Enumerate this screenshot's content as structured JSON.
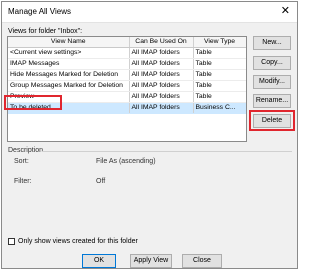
{
  "window": {
    "title": "Manage All Views",
    "close_glyph": "✕"
  },
  "views_label": "Views for folder \"Inbox\":",
  "table": {
    "columns": [
      "View Name",
      "Can Be Used On",
      "View Type"
    ],
    "rows": [
      {
        "name": "<Current view settings>",
        "used_on": "All IMAP folders",
        "type": "Table"
      },
      {
        "name": "IMAP Messages",
        "used_on": "All IMAP folders",
        "type": "Table"
      },
      {
        "name": "Hide Messages Marked for Deletion",
        "used_on": "All IMAP folders",
        "type": "Table"
      },
      {
        "name": "Group Messages Marked for Deletion",
        "used_on": "All IMAP folders",
        "type": "Table"
      },
      {
        "name": "Preview",
        "used_on": "All IMAP folders",
        "type": "Table"
      },
      {
        "name": "To be deleted",
        "used_on": "All IMAP folders",
        "type": "Business C..."
      }
    ],
    "selected_row": 5
  },
  "buttons": {
    "new": "New...",
    "copy": "Copy...",
    "modify": "Modify...",
    "rename": "Rename...",
    "delete": "Delete",
    "ok": "OK",
    "apply_view": "Apply View",
    "close": "Close"
  },
  "description": {
    "header": "Description",
    "sort_label": "Sort:",
    "sort_value": "File As (ascending)",
    "filter_label": "Filter:",
    "filter_value": "Off"
  },
  "checkbox": {
    "label": "Only show views created for this folder",
    "checked": false
  },
  "colors": {
    "highlight": "#e0262e",
    "selection": "#cde8ff",
    "default_button": "#0078d7"
  }
}
